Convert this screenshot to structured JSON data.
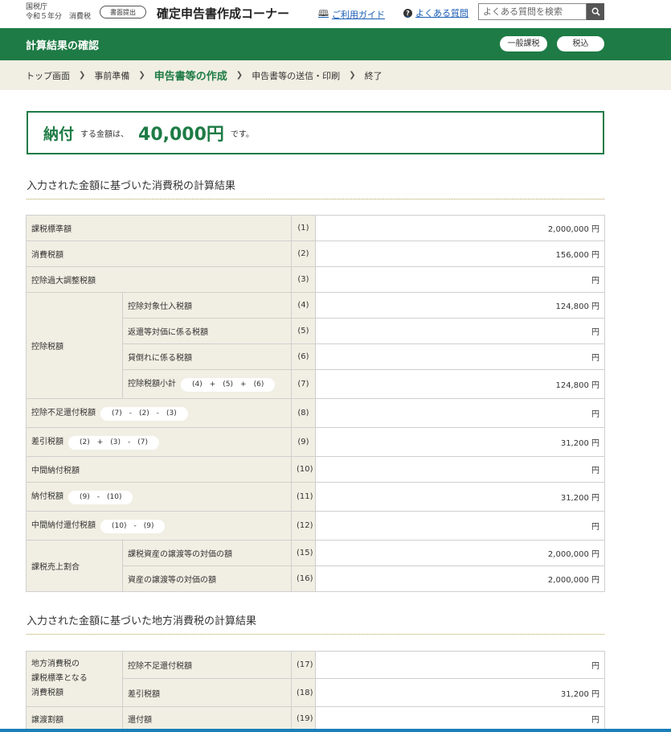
{
  "header": {
    "agency": "国税庁",
    "agency_sub": "令和５年分　消費税",
    "mode_badge": "書面提出",
    "site_title": "確定申告書作成コーナー",
    "guide_link": "ご利用ガイド",
    "faq_link": "よくある質問",
    "search_placeholder": "よくある質問を検索"
  },
  "green_bar": {
    "heading": "計算結果の確認",
    "pill_general": "一般課税",
    "pill_tax_inclusive": "税込"
  },
  "breadcrumb": [
    "トップ画面",
    "事前準備",
    "申告書等の作成",
    "申告書等の送信・印刷",
    "終了"
  ],
  "result": {
    "main": "納付",
    "small": "する金額は、",
    "amount": "40,000円",
    "end": "です。"
  },
  "section1": {
    "heading": "入力された金額に基づいた消費税の計算結果",
    "rows": {
      "r1": {
        "label": "課税標準額",
        "num": "(1)",
        "value": "2,000,000 円"
      },
      "r2": {
        "label": "消費税額",
        "num": "(2)",
        "value": "156,000 円"
      },
      "r3": {
        "label": "控除過大調整税額",
        "num": "(3)",
        "value": "円"
      },
      "group_deduction": "控除税額",
      "r4": {
        "label": "控除対象仕入税額",
        "num": "(4)",
        "value": "124,800 円"
      },
      "r5": {
        "label": "返還等対価に係る税額",
        "num": "(5)",
        "value": "円"
      },
      "r6": {
        "label": "貸倒れに係る税額",
        "num": "(6)",
        "value": "円"
      },
      "r7": {
        "label": "控除税額小計",
        "formula": "(4)　+　(5)　+　(6)",
        "num": "(7)",
        "value": "124,800 円"
      },
      "r8": {
        "label": "控除不足還付税額",
        "formula": "(7)　-　(2)　-　(3)",
        "num": "(8)",
        "value": "円"
      },
      "r9": {
        "label": "差引税額",
        "formula": "(2)　+　(3)　-　(7)",
        "num": "(9)",
        "value": "31,200 円"
      },
      "r10": {
        "label": "中間納付税額",
        "num": "(10)",
        "value": "円"
      },
      "r11": {
        "label": "納付税額",
        "formula": "(9)　-　(10)",
        "num": "(11)",
        "value": "31,200 円"
      },
      "r12": {
        "label": "中間納付還付税額",
        "formula": "(10)　-　(9)",
        "num": "(12)",
        "value": "円"
      },
      "group_ratio": "課税売上割合",
      "r15": {
        "label": "課税資産の譲渡等の対価の額",
        "num": "(15)",
        "value": "2,000,000 円"
      },
      "r16": {
        "label": "資産の譲渡等の対価の額",
        "num": "(16)",
        "value": "2,000,000 円"
      }
    }
  },
  "section2": {
    "heading": "入力された金額に基づいた地方消費税の計算結果",
    "group_local": [
      "地方消費税の",
      "課税標準となる",
      "消費税額"
    ],
    "r17": {
      "label": "控除不足還付税額",
      "num": "(17)",
      "value": "円"
    },
    "r18": {
      "label": "差引税額",
      "num": "(18)",
      "value": "31,200 円"
    },
    "group_transfer": "譲渡割額",
    "r19": {
      "label": "還付額",
      "num": "(19)",
      "value": "円"
    }
  },
  "colors": {
    "brand_green": "#1e7b45",
    "label_bg": "#f1efe3"
  },
  "icons": {
    "guide": "book-icon",
    "faq": "question-circle-icon",
    "search": "magnifier-icon"
  }
}
